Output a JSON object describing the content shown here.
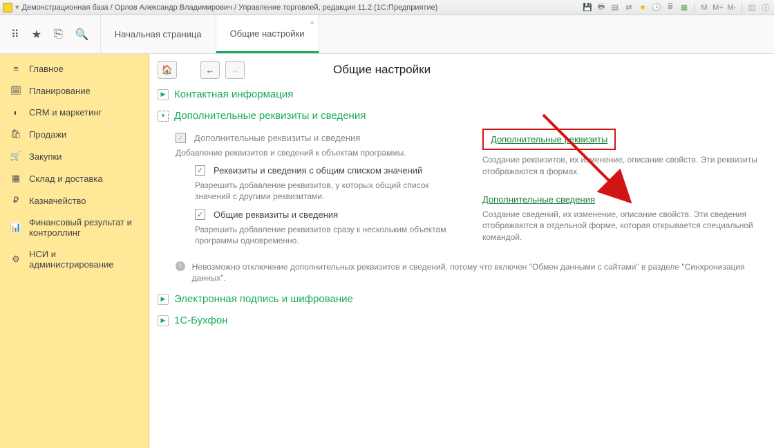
{
  "titlebar": {
    "title": "Демонстрационная база / Орлов Александр Владимирович / Управление торговлей, редакция 11.2  (1С:Предприятие)"
  },
  "tabs": {
    "start_label": "Начальная страница",
    "settings_label": "Общие настройки"
  },
  "sidebar": {
    "items": [
      {
        "icon": "≡",
        "label": "Главное"
      },
      {
        "icon": "📅",
        "label": "Планирование"
      },
      {
        "icon": "◐",
        "label": "CRM и маркетинг"
      },
      {
        "icon": "🛍",
        "label": "Продажи"
      },
      {
        "icon": "🛒",
        "label": "Закупки"
      },
      {
        "icon": "▦",
        "label": "Склад и доставка"
      },
      {
        "icon": "₽",
        "label": "Казначейство"
      },
      {
        "icon": "📊",
        "label": "Финансовый результат и контроллинг"
      },
      {
        "icon": "⚙",
        "label": "НСИ и администрирование"
      }
    ]
  },
  "page": {
    "title": "Общие настройки",
    "sections": {
      "contact": {
        "title": "Контактная информация"
      },
      "additional": {
        "title": "Дополнительные реквизиты и сведения",
        "chk_main_label": "Дополнительные реквизиты и сведения",
        "desc_main": "Добавление реквизитов и сведений к объектам программы.",
        "chk_shared_label": "Реквизиты и сведения с общим списком значений",
        "desc_shared": "Разрешить добавление реквизитов, у которых общий список значений с другими реквизитами.",
        "chk_common_label": "Общие реквизиты и сведения",
        "desc_common": "Разрешить добавление реквизитов сразу к нескольким объектам программы одновременно.",
        "link_attrs": "Дополнительные реквизиты",
        "desc_attrs": "Создание реквизитов, их изменение, описание свойств. Эти реквизиты отображаются в формах.",
        "link_info": "Дополнительные сведения",
        "desc_info": "Создание сведений, их изменение, описание свойств. Эти сведения отображаются в отдельной форме, которая открывается специальной командой.",
        "info_text": "Невозможно отключение дополнительных реквизитов и сведений, потому что включен \"Обмен данными с сайтами\" в разделе \"Синхронизация данных\"."
      },
      "signature": {
        "title": "Электронная подпись и шифрование"
      },
      "buhphone": {
        "title": "1С-Бухфон"
      }
    }
  }
}
